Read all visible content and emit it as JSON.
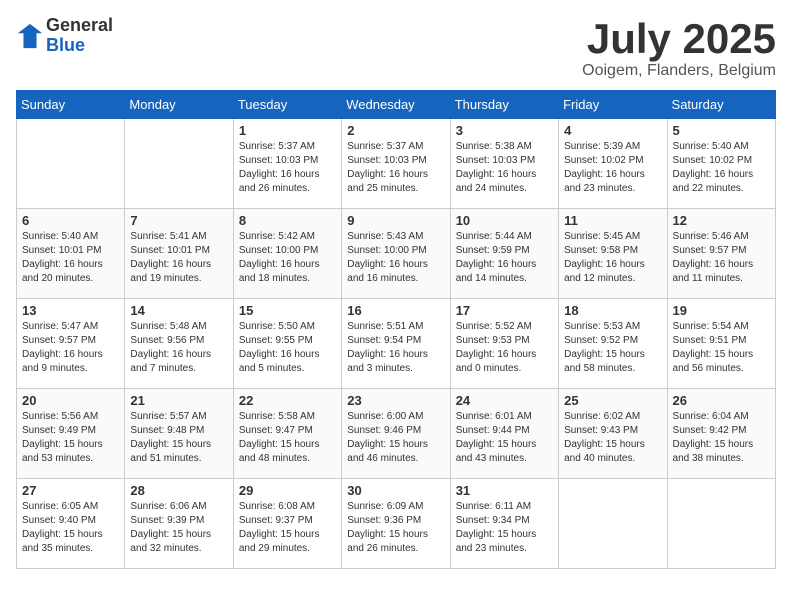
{
  "header": {
    "logo_line1": "General",
    "logo_line2": "Blue",
    "month": "July 2025",
    "location": "Ooigem, Flanders, Belgium"
  },
  "weekdays": [
    "Sunday",
    "Monday",
    "Tuesday",
    "Wednesday",
    "Thursday",
    "Friday",
    "Saturday"
  ],
  "weeks": [
    [
      {
        "day": "",
        "info": ""
      },
      {
        "day": "",
        "info": ""
      },
      {
        "day": "1",
        "info": "Sunrise: 5:37 AM\nSunset: 10:03 PM\nDaylight: 16 hours\nand 26 minutes."
      },
      {
        "day": "2",
        "info": "Sunrise: 5:37 AM\nSunset: 10:03 PM\nDaylight: 16 hours\nand 25 minutes."
      },
      {
        "day": "3",
        "info": "Sunrise: 5:38 AM\nSunset: 10:03 PM\nDaylight: 16 hours\nand 24 minutes."
      },
      {
        "day": "4",
        "info": "Sunrise: 5:39 AM\nSunset: 10:02 PM\nDaylight: 16 hours\nand 23 minutes."
      },
      {
        "day": "5",
        "info": "Sunrise: 5:40 AM\nSunset: 10:02 PM\nDaylight: 16 hours\nand 22 minutes."
      }
    ],
    [
      {
        "day": "6",
        "info": "Sunrise: 5:40 AM\nSunset: 10:01 PM\nDaylight: 16 hours\nand 20 minutes."
      },
      {
        "day": "7",
        "info": "Sunrise: 5:41 AM\nSunset: 10:01 PM\nDaylight: 16 hours\nand 19 minutes."
      },
      {
        "day": "8",
        "info": "Sunrise: 5:42 AM\nSunset: 10:00 PM\nDaylight: 16 hours\nand 18 minutes."
      },
      {
        "day": "9",
        "info": "Sunrise: 5:43 AM\nSunset: 10:00 PM\nDaylight: 16 hours\nand 16 minutes."
      },
      {
        "day": "10",
        "info": "Sunrise: 5:44 AM\nSunset: 9:59 PM\nDaylight: 16 hours\nand 14 minutes."
      },
      {
        "day": "11",
        "info": "Sunrise: 5:45 AM\nSunset: 9:58 PM\nDaylight: 16 hours\nand 12 minutes."
      },
      {
        "day": "12",
        "info": "Sunrise: 5:46 AM\nSunset: 9:57 PM\nDaylight: 16 hours\nand 11 minutes."
      }
    ],
    [
      {
        "day": "13",
        "info": "Sunrise: 5:47 AM\nSunset: 9:57 PM\nDaylight: 16 hours\nand 9 minutes."
      },
      {
        "day": "14",
        "info": "Sunrise: 5:48 AM\nSunset: 9:56 PM\nDaylight: 16 hours\nand 7 minutes."
      },
      {
        "day": "15",
        "info": "Sunrise: 5:50 AM\nSunset: 9:55 PM\nDaylight: 16 hours\nand 5 minutes."
      },
      {
        "day": "16",
        "info": "Sunrise: 5:51 AM\nSunset: 9:54 PM\nDaylight: 16 hours\nand 3 minutes."
      },
      {
        "day": "17",
        "info": "Sunrise: 5:52 AM\nSunset: 9:53 PM\nDaylight: 16 hours\nand 0 minutes."
      },
      {
        "day": "18",
        "info": "Sunrise: 5:53 AM\nSunset: 9:52 PM\nDaylight: 15 hours\nand 58 minutes."
      },
      {
        "day": "19",
        "info": "Sunrise: 5:54 AM\nSunset: 9:51 PM\nDaylight: 15 hours\nand 56 minutes."
      }
    ],
    [
      {
        "day": "20",
        "info": "Sunrise: 5:56 AM\nSunset: 9:49 PM\nDaylight: 15 hours\nand 53 minutes."
      },
      {
        "day": "21",
        "info": "Sunrise: 5:57 AM\nSunset: 9:48 PM\nDaylight: 15 hours\nand 51 minutes."
      },
      {
        "day": "22",
        "info": "Sunrise: 5:58 AM\nSunset: 9:47 PM\nDaylight: 15 hours\nand 48 minutes."
      },
      {
        "day": "23",
        "info": "Sunrise: 6:00 AM\nSunset: 9:46 PM\nDaylight: 15 hours\nand 46 minutes."
      },
      {
        "day": "24",
        "info": "Sunrise: 6:01 AM\nSunset: 9:44 PM\nDaylight: 15 hours\nand 43 minutes."
      },
      {
        "day": "25",
        "info": "Sunrise: 6:02 AM\nSunset: 9:43 PM\nDaylight: 15 hours\nand 40 minutes."
      },
      {
        "day": "26",
        "info": "Sunrise: 6:04 AM\nSunset: 9:42 PM\nDaylight: 15 hours\nand 38 minutes."
      }
    ],
    [
      {
        "day": "27",
        "info": "Sunrise: 6:05 AM\nSunset: 9:40 PM\nDaylight: 15 hours\nand 35 minutes."
      },
      {
        "day": "28",
        "info": "Sunrise: 6:06 AM\nSunset: 9:39 PM\nDaylight: 15 hours\nand 32 minutes."
      },
      {
        "day": "29",
        "info": "Sunrise: 6:08 AM\nSunset: 9:37 PM\nDaylight: 15 hours\nand 29 minutes."
      },
      {
        "day": "30",
        "info": "Sunrise: 6:09 AM\nSunset: 9:36 PM\nDaylight: 15 hours\nand 26 minutes."
      },
      {
        "day": "31",
        "info": "Sunrise: 6:11 AM\nSunset: 9:34 PM\nDaylight: 15 hours\nand 23 minutes."
      },
      {
        "day": "",
        "info": ""
      },
      {
        "day": "",
        "info": ""
      }
    ]
  ]
}
